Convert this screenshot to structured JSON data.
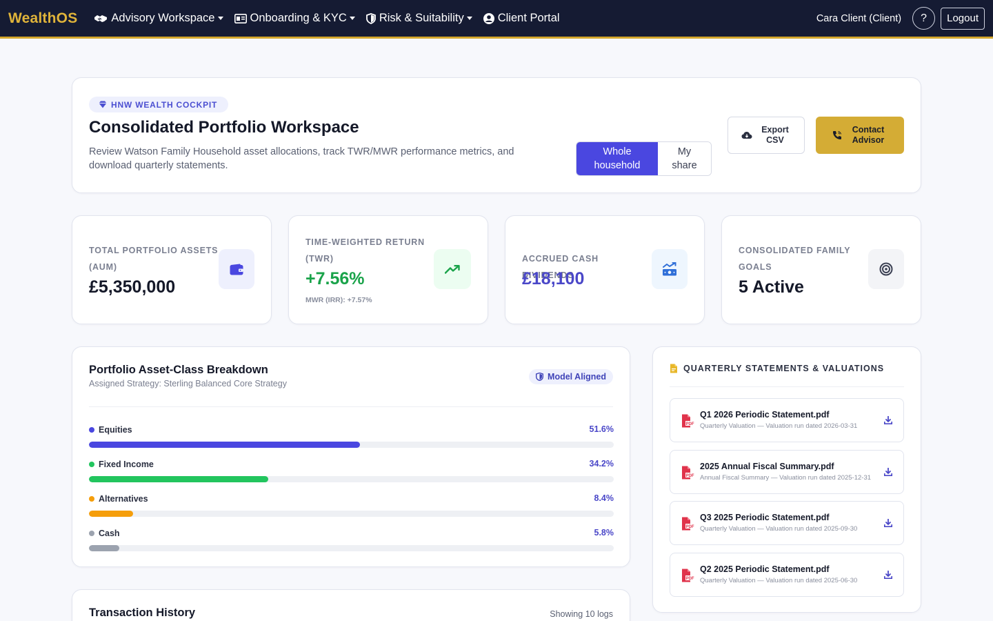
{
  "nav": {
    "brand": "WealthOS",
    "items": [
      {
        "label": "Advisory Workspace",
        "icon": "handshake-icon",
        "dropdown": true
      },
      {
        "label": "Onboarding & KYC",
        "icon": "id-card-icon",
        "dropdown": true
      },
      {
        "label": "Risk & Suitability",
        "icon": "shield-icon",
        "dropdown": true
      },
      {
        "label": "Client Portal",
        "icon": "user-circle-icon",
        "dropdown": false
      }
    ],
    "user": "Cara Client (Client)",
    "help": "?",
    "logout": "Logout"
  },
  "hero": {
    "pill": "HNW WEALTH COCKPIT",
    "title": "Consolidated Portfolio Workspace",
    "description": "Review Watson Family Household asset allocations, track TWR/MWR performance metrics, and download quarterly statements.",
    "view_toggle": {
      "active": "Whole household",
      "other": "My share"
    },
    "export_label": "Export CSV",
    "contact_label": "Contact Advisor"
  },
  "kpis": [
    {
      "label": "TOTAL PORTFOLIO ASSETS (AUM)",
      "value": "£5,350,000",
      "sub": "",
      "icon": "wallet-icon",
      "value_color": "#141828"
    },
    {
      "label": "TIME-WEIGHTED RETURN (TWR)",
      "value": "+7.56%",
      "sub": "MWR (IRR): +7.57%",
      "icon": "trend-up-icon",
      "value_color": "#1aa34a"
    },
    {
      "label": "ACCRUED CASH DIVIDENDS",
      "value": "£18,100",
      "sub": "",
      "icon": "money-chart-icon",
      "value_color": "#4a47c8"
    },
    {
      "label": "CONSOLIDATED FAMILY GOALS",
      "value": "5 Active",
      "sub": "",
      "icon": "target-icon",
      "value_color": "#141828"
    }
  ],
  "allocation": {
    "title": "Portfolio Asset-Class Breakdown",
    "subtitle": "Assigned Strategy: Sterling Balanced Core Strategy",
    "badge": "Model Aligned",
    "rows": [
      {
        "label": "Equities",
        "pct_text": "51.6%",
        "pct": 51.6,
        "color": "#4a47e0"
      },
      {
        "label": "Fixed Income",
        "pct_text": "34.2%",
        "pct": 34.2,
        "color": "#22c55e"
      },
      {
        "label": "Alternatives",
        "pct_text": "8.4%",
        "pct": 8.4,
        "color": "#f59e0b"
      },
      {
        "label": "Cash",
        "pct_text": "5.8%",
        "pct": 5.8,
        "color": "#9ca3af"
      }
    ]
  },
  "statements": {
    "title": "QUARTERLY STATEMENTS & VALUATIONS",
    "docs": [
      {
        "name": "Q1 2026 Periodic Statement.pdf",
        "meta": "Quarterly Valuation — Valuation run dated 2026-03-31"
      },
      {
        "name": "2025 Annual Fiscal Summary.pdf",
        "meta": "Annual Fiscal Summary — Valuation run dated 2025-12-31"
      },
      {
        "name": "Q3 2025 Periodic Statement.pdf",
        "meta": "Quarterly Valuation — Valuation run dated 2025-09-30"
      },
      {
        "name": "Q2 2025 Periodic Statement.pdf",
        "meta": "Quarterly Valuation — Valuation run dated 2025-06-30"
      }
    ]
  },
  "transactions": {
    "title": "Transaction History",
    "count": "Showing 10 logs"
  }
}
